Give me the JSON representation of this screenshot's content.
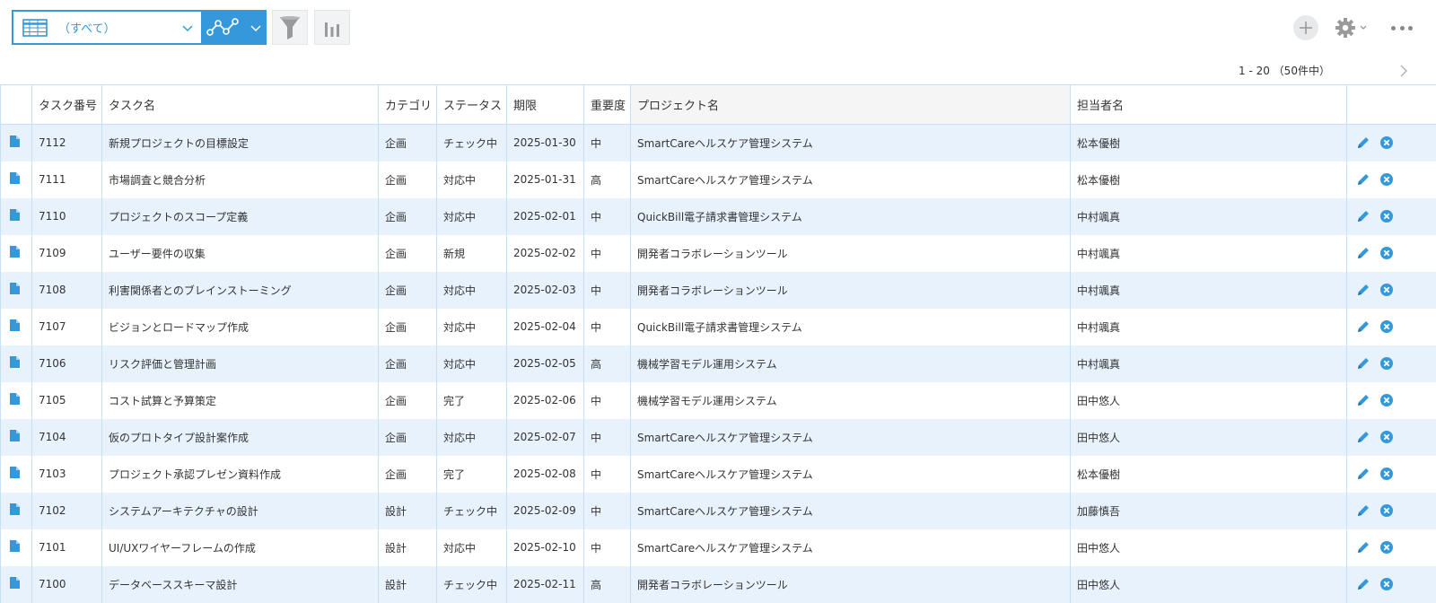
{
  "toolbar": {
    "view_label": "（すべて）",
    "icons": {
      "view": "table-icon",
      "view_dropdown": "chevron-down-icon",
      "graph": "graph-icon",
      "filter": "filter-icon",
      "chart": "bar-chart-icon",
      "add": "plus-icon",
      "settings": "gear-icon",
      "more": "more-icon"
    }
  },
  "pager": {
    "text": "1 - 20 （50件中）"
  },
  "table": {
    "columns": [
      "タスク番号",
      "タスク名",
      "カテゴリ",
      "ステータス",
      "期限",
      "重要度",
      "プロジェクト名",
      "担当者名"
    ],
    "rows": [
      {
        "id": "7112",
        "name": "新規プロジェクトの目標設定",
        "category": "企画",
        "status": "チェック中",
        "due": "2025-01-30",
        "priority": "中",
        "project": "SmartCareヘルスケア管理システム",
        "assignee": "松本優樹"
      },
      {
        "id": "7111",
        "name": "市場調査と競合分析",
        "category": "企画",
        "status": "対応中",
        "due": "2025-01-31",
        "priority": "高",
        "project": "SmartCareヘルスケア管理システム",
        "assignee": "松本優樹"
      },
      {
        "id": "7110",
        "name": "プロジェクトのスコープ定義",
        "category": "企画",
        "status": "対応中",
        "due": "2025-02-01",
        "priority": "中",
        "project": "QuickBill電子請求書管理システム",
        "assignee": "中村颯真"
      },
      {
        "id": "7109",
        "name": "ユーザー要件の収集",
        "category": "企画",
        "status": "新規",
        "due": "2025-02-02",
        "priority": "中",
        "project": "開発者コラボレーションツール",
        "assignee": "中村颯真"
      },
      {
        "id": "7108",
        "name": "利害関係者とのブレインストーミング",
        "category": "企画",
        "status": "対応中",
        "due": "2025-02-03",
        "priority": "中",
        "project": "開発者コラボレーションツール",
        "assignee": "中村颯真"
      },
      {
        "id": "7107",
        "name": "ビジョンとロードマップ作成",
        "category": "企画",
        "status": "対応中",
        "due": "2025-02-04",
        "priority": "中",
        "project": "QuickBill電子請求書管理システム",
        "assignee": "中村颯真"
      },
      {
        "id": "7106",
        "name": "リスク評価と管理計画",
        "category": "企画",
        "status": "対応中",
        "due": "2025-02-05",
        "priority": "高",
        "project": "機械学習モデル運用システム",
        "assignee": "中村颯真"
      },
      {
        "id": "7105",
        "name": "コスト試算と予算策定",
        "category": "企画",
        "status": "完了",
        "due": "2025-02-06",
        "priority": "中",
        "project": "機械学習モデル運用システム",
        "assignee": "田中悠人"
      },
      {
        "id": "7104",
        "name": "仮のプロトタイプ設計案作成",
        "category": "企画",
        "status": "対応中",
        "due": "2025-02-07",
        "priority": "中",
        "project": "SmartCareヘルスケア管理システム",
        "assignee": "田中悠人"
      },
      {
        "id": "7103",
        "name": "プロジェクト承認プレゼン資料作成",
        "category": "企画",
        "status": "完了",
        "due": "2025-02-08",
        "priority": "中",
        "project": "SmartCareヘルスケア管理システム",
        "assignee": "松本優樹"
      },
      {
        "id": "7102",
        "name": "システムアーキテクチャの設計",
        "category": "設計",
        "status": "チェック中",
        "due": "2025-02-09",
        "priority": "中",
        "project": "SmartCareヘルスケア管理システム",
        "assignee": "加藤慎吾"
      },
      {
        "id": "7101",
        "name": "UI/UXワイヤーフレームの作成",
        "category": "設計",
        "status": "対応中",
        "due": "2025-02-10",
        "priority": "中",
        "project": "SmartCareヘルスケア管理システム",
        "assignee": "田中悠人"
      },
      {
        "id": "7100",
        "name": "データベーススキーマ設計",
        "category": "設計",
        "status": "チェック中",
        "due": "2025-02-11",
        "priority": "高",
        "project": "開発者コラボレーションツール",
        "assignee": "田中悠人"
      }
    ],
    "row_icons": {
      "detail": "document-icon",
      "edit": "pencil-icon",
      "delete": "delete-icon"
    }
  },
  "colors": {
    "accent": "#3498db",
    "row_alt": "#e8f2fc",
    "border": "#c5e1f6"
  }
}
